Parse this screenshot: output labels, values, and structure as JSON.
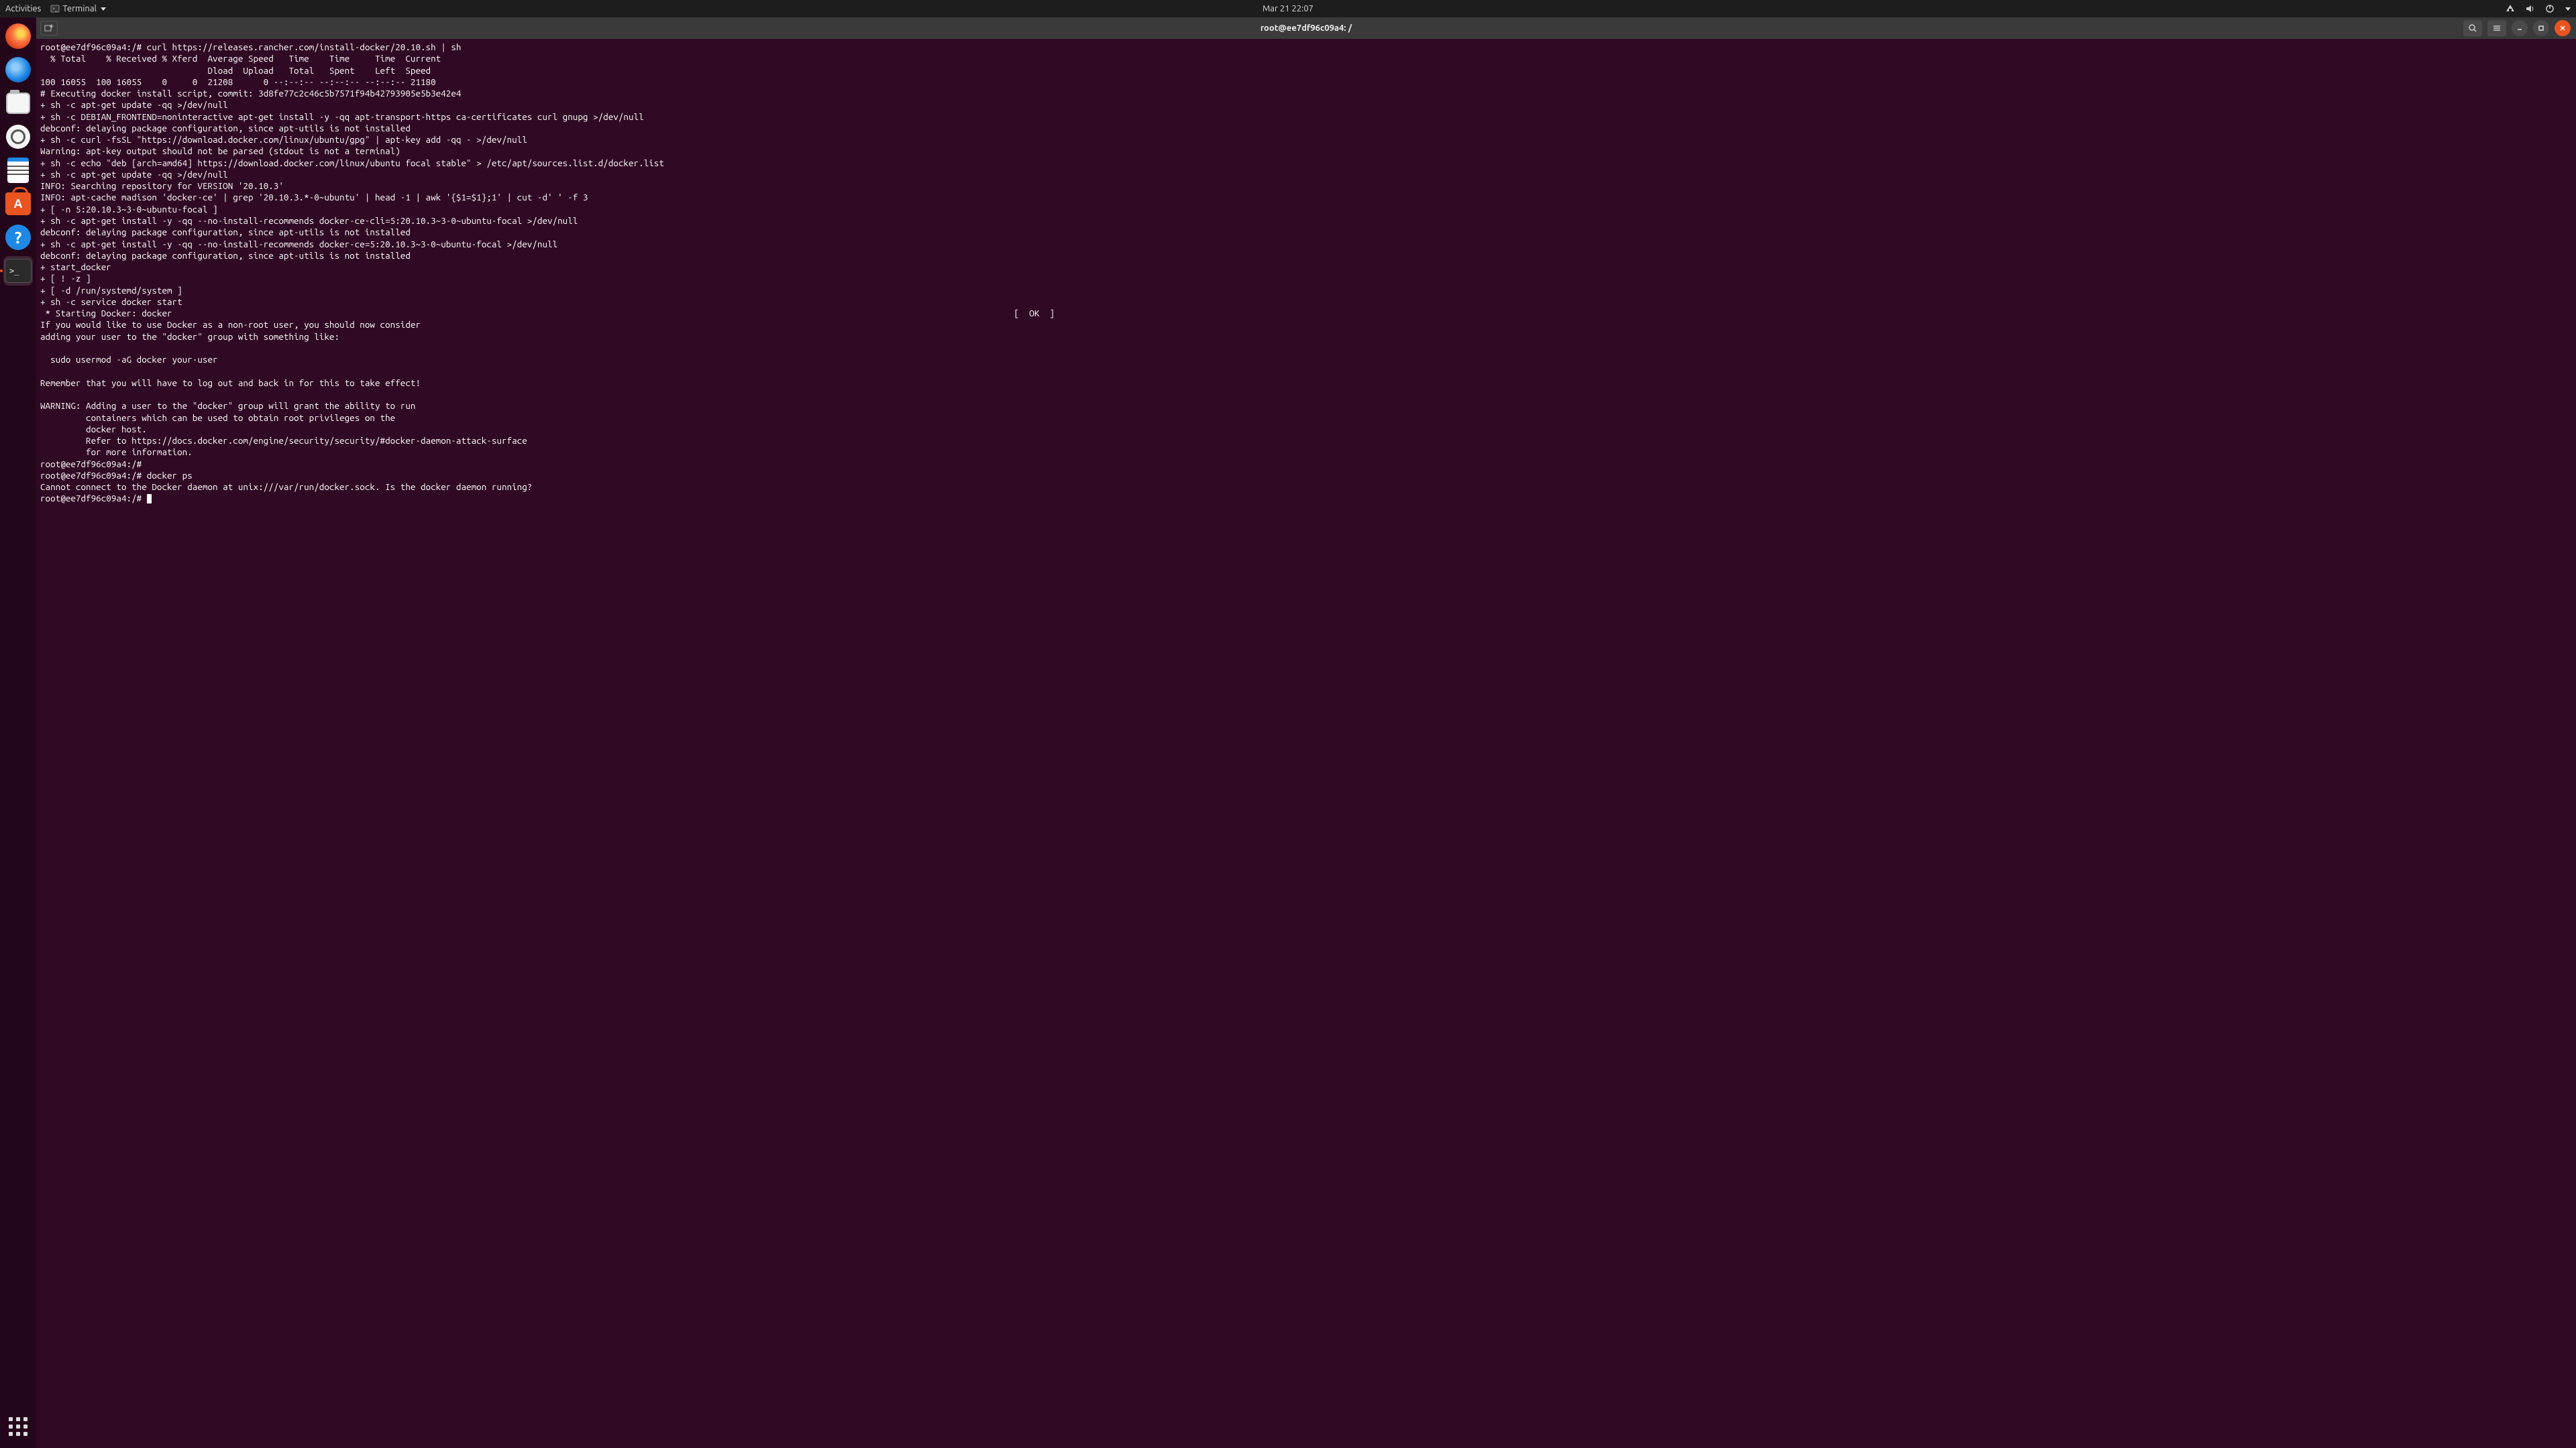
{
  "top_panel": {
    "activities": "Activities",
    "app_menu": "Terminal",
    "clock": "Mar 21  22:07"
  },
  "dock": {
    "items": [
      {
        "name": "firefox",
        "label": "Firefox"
      },
      {
        "name": "thunderbird",
        "label": "Thunderbird"
      },
      {
        "name": "files",
        "label": "Files"
      },
      {
        "name": "rhythmbox",
        "label": "Rhythmbox"
      },
      {
        "name": "writer",
        "label": "LibreOffice Writer"
      },
      {
        "name": "software",
        "label": "Ubuntu Software"
      },
      {
        "name": "help",
        "label": "Help"
      },
      {
        "name": "terminal",
        "label": "Terminal",
        "active": true
      }
    ],
    "show_apps": "Show Applications"
  },
  "window": {
    "title": "root@ee7df96c09a4: /"
  },
  "terminal": {
    "ok_tag": "[  OK  ]",
    "lines": [
      "root@ee7df96c09a4:/# curl https://releases.rancher.com/install-docker/20.10.sh | sh",
      "  % Total    % Received % Xferd  Average Speed   Time    Time     Time  Current",
      "                                 Dload  Upload   Total   Spent    Left  Speed",
      "100 16055  100 16055    0     0  21208      0 --:--:-- --:--:-- --:--:-- 21180",
      "# Executing docker install script, commit: 3d8fe77c2c46c5b7571f94b42793905e5b3e42e4",
      "+ sh -c apt-get update -qq >/dev/null",
      "+ sh -c DEBIAN_FRONTEND=noninteractive apt-get install -y -qq apt-transport-https ca-certificates curl gnupg >/dev/null",
      "debconf: delaying package configuration, since apt-utils is not installed",
      "+ sh -c curl -fsSL \"https://download.docker.com/linux/ubuntu/gpg\" | apt-key add -qq - >/dev/null",
      "Warning: apt-key output should not be parsed (stdout is not a terminal)",
      "+ sh -c echo \"deb [arch=amd64] https://download.docker.com/linux/ubuntu focal stable\" > /etc/apt/sources.list.d/docker.list",
      "+ sh -c apt-get update -qq >/dev/null",
      "INFO: Searching repository for VERSION '20.10.3'",
      "INFO: apt-cache madison 'docker-ce' | grep '20.10.3.*-0~ubuntu' | head -1 | awk '{$1=$1};1' | cut -d' ' -f 3",
      "+ [ -n 5:20.10.3~3-0~ubuntu-focal ]",
      "+ sh -c apt-get install -y -qq --no-install-recommends docker-ce-cli=5:20.10.3~3-0~ubuntu-focal >/dev/null",
      "debconf: delaying package configuration, since apt-utils is not installed",
      "+ sh -c apt-get install -y -qq --no-install-recommends docker-ce=5:20.10.3~3-0~ubuntu-focal >/dev/null",
      "debconf: delaying package configuration, since apt-utils is not installed",
      "+ start_docker",
      "+ [ ! -z ]",
      "+ [ -d /run/systemd/system ]",
      "+ sh -c service docker start",
      " * Starting Docker: docker",
      "If you would like to use Docker as a non-root user, you should now consider",
      "adding your user to the \"docker\" group with something like:",
      "",
      "  sudo usermod -aG docker your-user",
      "",
      "Remember that you will have to log out and back in for this to take effect!",
      "",
      "WARNING: Adding a user to the \"docker\" group will grant the ability to run",
      "         containers which can be used to obtain root privileges on the",
      "         docker host.",
      "         Refer to https://docs.docker.com/engine/security/security/#docker-daemon-attack-surface",
      "         for more information.",
      "root@ee7df96c09a4:/# ",
      "root@ee7df96c09a4:/# docker ps",
      "Cannot connect to the Docker daemon at unix:///var/run/docker.sock. Is the docker daemon running?",
      "root@ee7df96c09a4:/# "
    ],
    "ok_line_index": 23
  }
}
